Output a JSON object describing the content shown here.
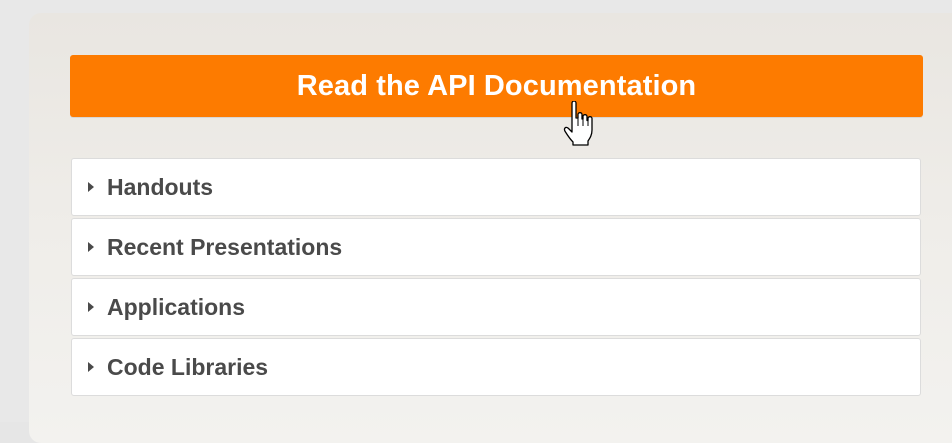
{
  "api_button": {
    "label": "Read the API Documentation",
    "color": "#fd7b00"
  },
  "accordion": {
    "items": [
      {
        "label": "Handouts"
      },
      {
        "label": "Recent Presentations"
      },
      {
        "label": "Applications"
      },
      {
        "label": "Code Libraries"
      }
    ]
  },
  "cursor": {
    "icon": "hand-pointer-icon"
  }
}
